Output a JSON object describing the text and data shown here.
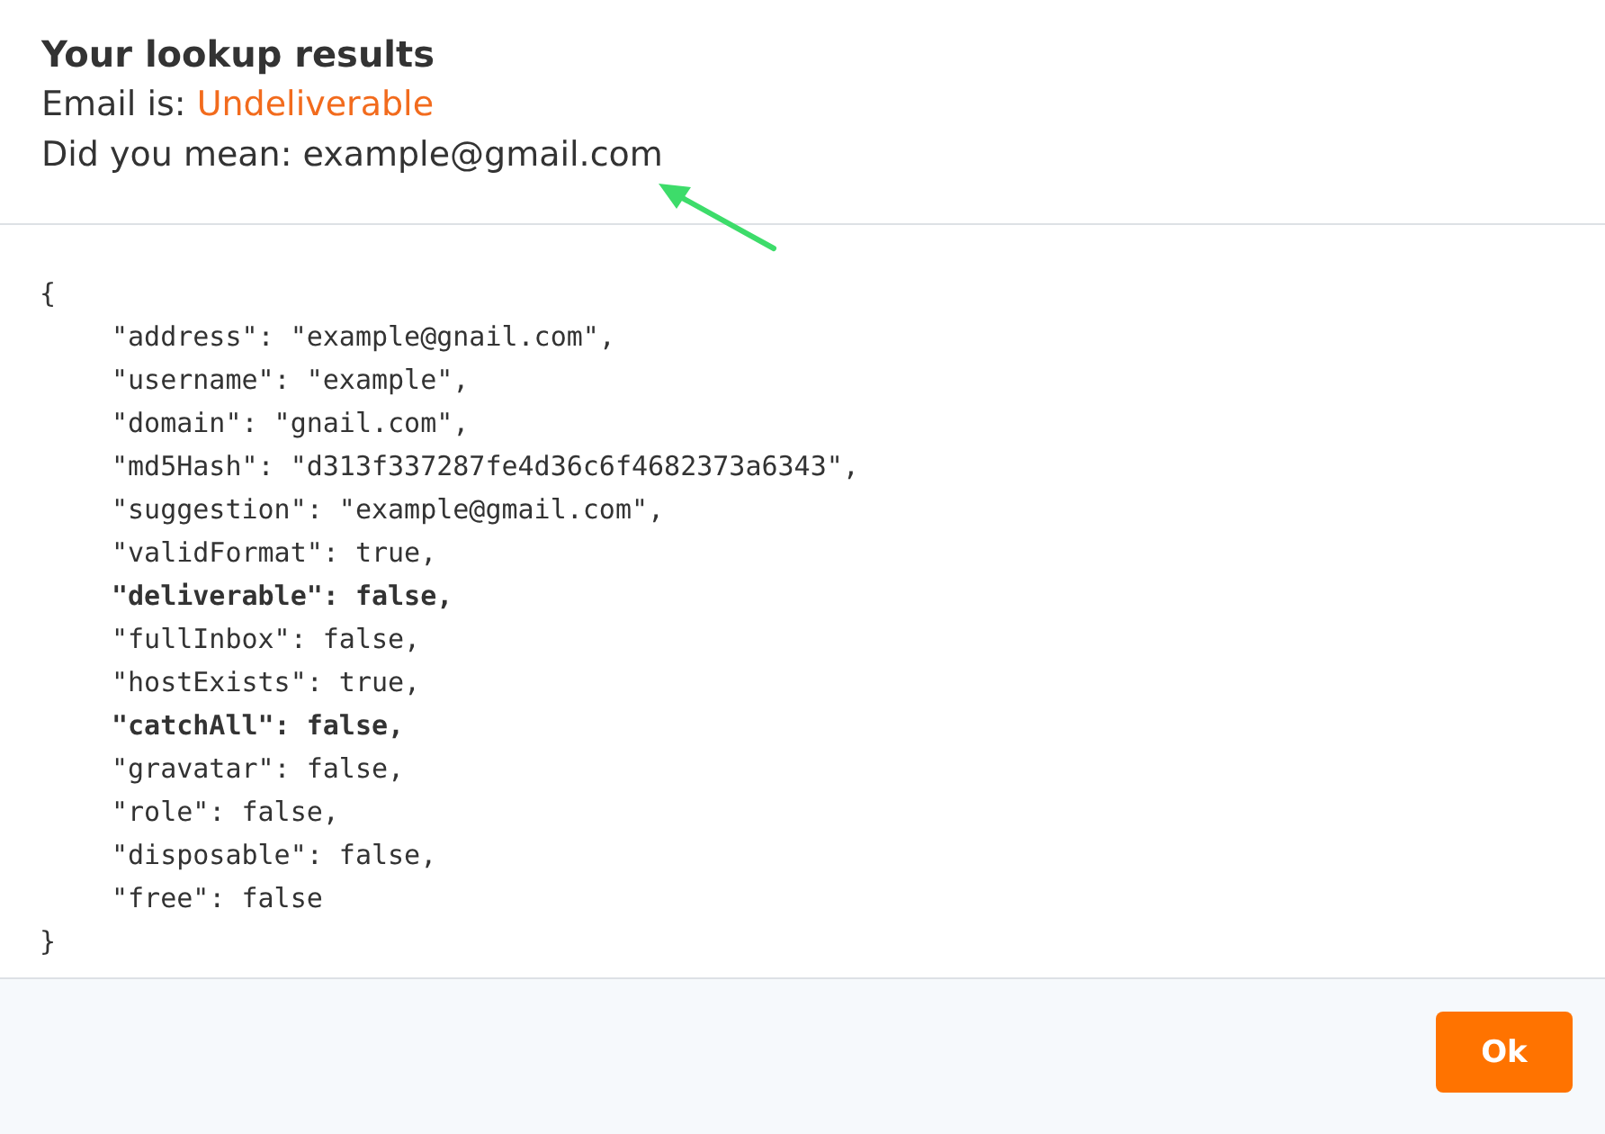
{
  "header": {
    "title": "Your lookup results",
    "status_label": "Email is:",
    "status_value": "Undeliverable",
    "suggestion_label": "Did you mean:",
    "suggestion_value": "example@gmail.com"
  },
  "code": {
    "lines": [
      {
        "kind": "brace",
        "text": "{",
        "bold": false
      },
      {
        "kind": "entry",
        "text": "\"address\": \"example@gnail.com\",",
        "bold": false
      },
      {
        "kind": "entry",
        "text": "\"username\": \"example\",",
        "bold": false
      },
      {
        "kind": "entry",
        "text": "\"domain\": \"gnail.com\",",
        "bold": false
      },
      {
        "kind": "entry",
        "text": "\"md5Hash\": \"d313f337287fe4d36c6f4682373a6343\",",
        "bold": false
      },
      {
        "kind": "entry",
        "text": "\"suggestion\": \"example@gmail.com\",",
        "bold": false
      },
      {
        "kind": "entry",
        "text": "\"validFormat\": true,",
        "bold": false
      },
      {
        "kind": "entry",
        "text": "\"deliverable\": false,",
        "bold": true
      },
      {
        "kind": "entry",
        "text": "\"fullInbox\": false,",
        "bold": false
      },
      {
        "kind": "entry",
        "text": "\"hostExists\": true,",
        "bold": false
      },
      {
        "kind": "entry",
        "text": "\"catchAll\": false,",
        "bold": true
      },
      {
        "kind": "entry",
        "text": "\"gravatar\": false,",
        "bold": false
      },
      {
        "kind": "entry",
        "text": "\"role\": false,",
        "bold": false
      },
      {
        "kind": "entry",
        "text": "\"disposable\": false,",
        "bold": false
      },
      {
        "kind": "entry",
        "text": "\"free\": false",
        "bold": false
      },
      {
        "kind": "brace",
        "text": "}",
        "bold": false
      }
    ]
  },
  "footer": {
    "button": "Ok"
  }
}
